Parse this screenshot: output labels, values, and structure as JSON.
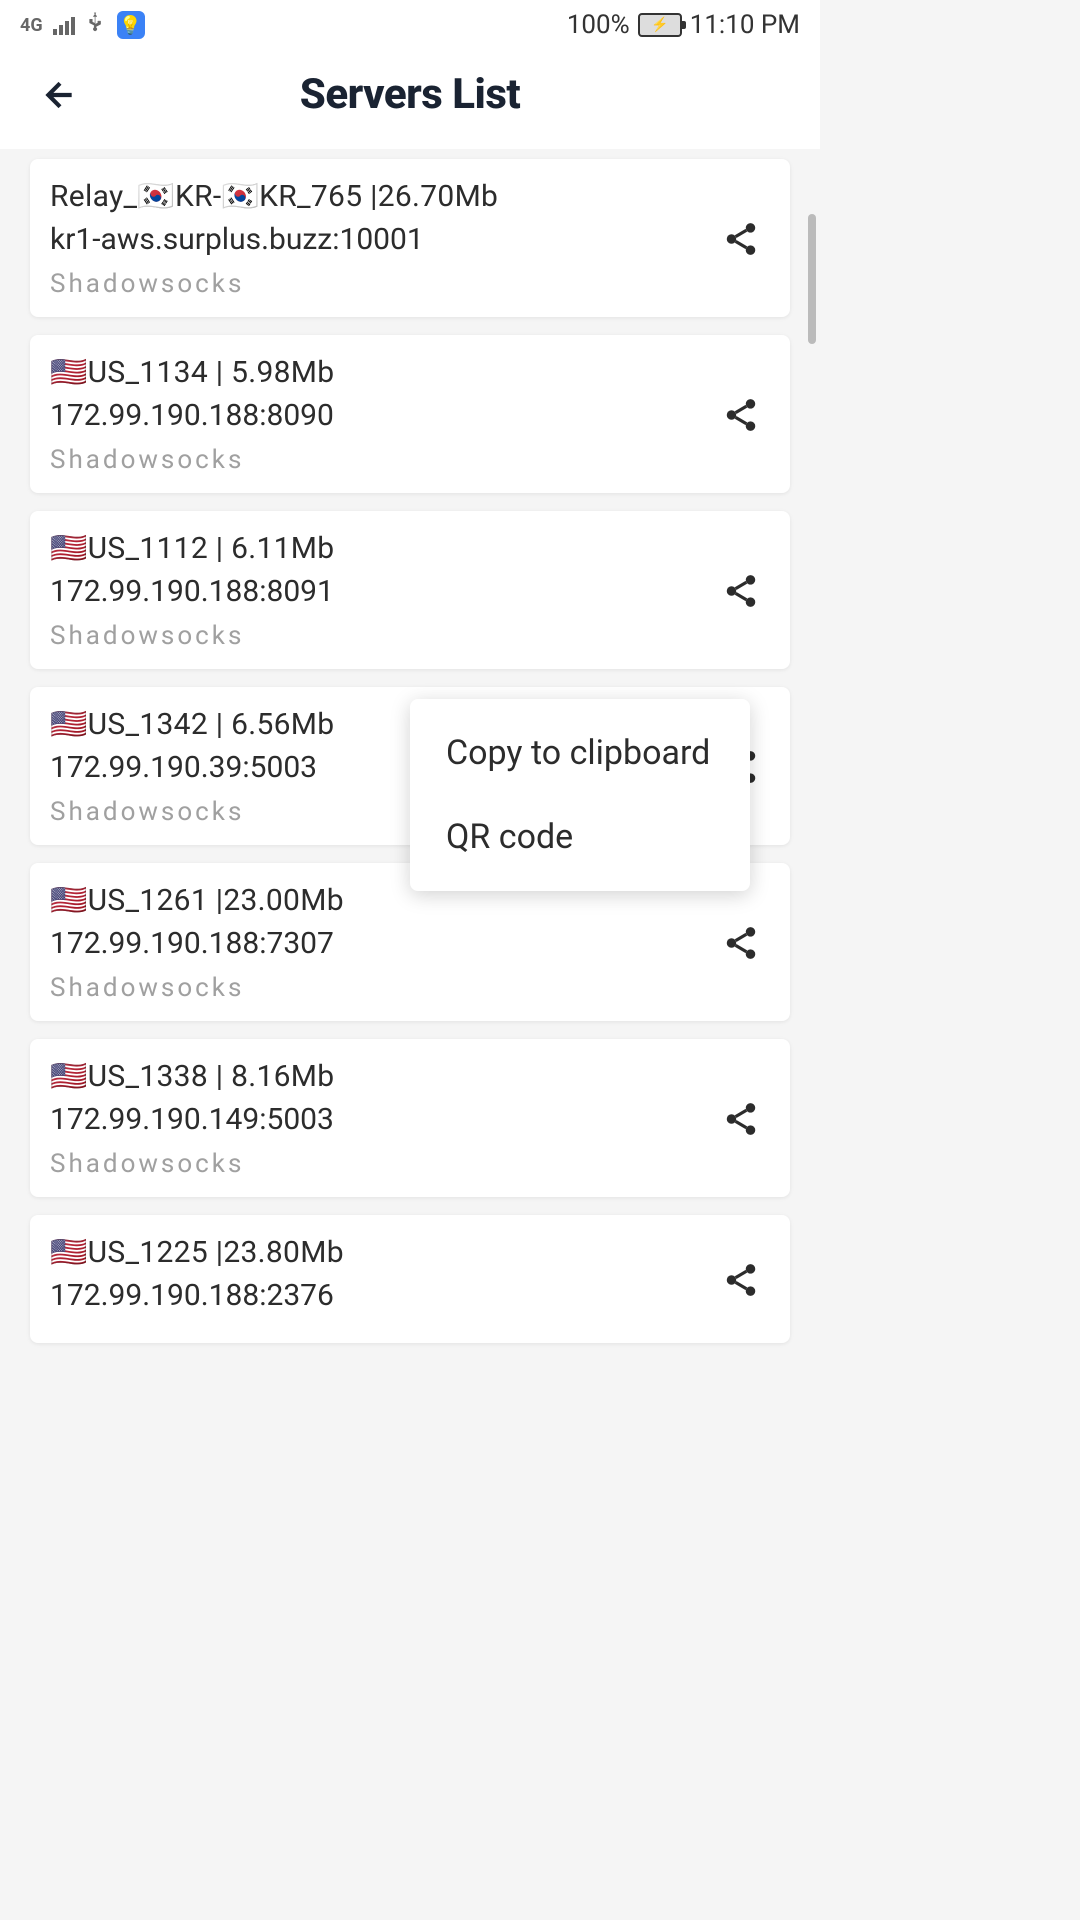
{
  "statusBar": {
    "networkType": "4G",
    "batteryPercent": "100%",
    "time": "11:10 PM"
  },
  "header": {
    "title": "Servers List"
  },
  "servers": [
    {
      "name": "Relay_🇰🇷KR-🇰🇷KR_765 |26.70Mb",
      "address": "kr1-aws.surplus.buzz:10001",
      "protocol": "Shadowsocks"
    },
    {
      "name": "🇺🇸US_1134 | 5.98Mb",
      "address": "172.99.190.188:8090",
      "protocol": "Shadowsocks"
    },
    {
      "name": "🇺🇸US_1112 | 6.11Mb",
      "address": "172.99.190.188:8091",
      "protocol": "Shadowsocks"
    },
    {
      "name": "🇺🇸US_1342 | 6.56Mb",
      "address": "172.99.190.39:5003",
      "protocol": "Shadowsocks"
    },
    {
      "name": "🇺🇸US_1261 |23.00Mb",
      "address": "172.99.190.188:7307",
      "protocol": "Shadowsocks"
    },
    {
      "name": "🇺🇸US_1338 | 8.16Mb",
      "address": "172.99.190.149:5003",
      "protocol": "Shadowsocks"
    },
    {
      "name": "🇺🇸US_1225 |23.80Mb",
      "address": "172.99.190.188:2376",
      "protocol": ""
    }
  ],
  "contextMenu": {
    "copyLabel": "Copy to clipboard",
    "qrLabel": "QR code"
  }
}
